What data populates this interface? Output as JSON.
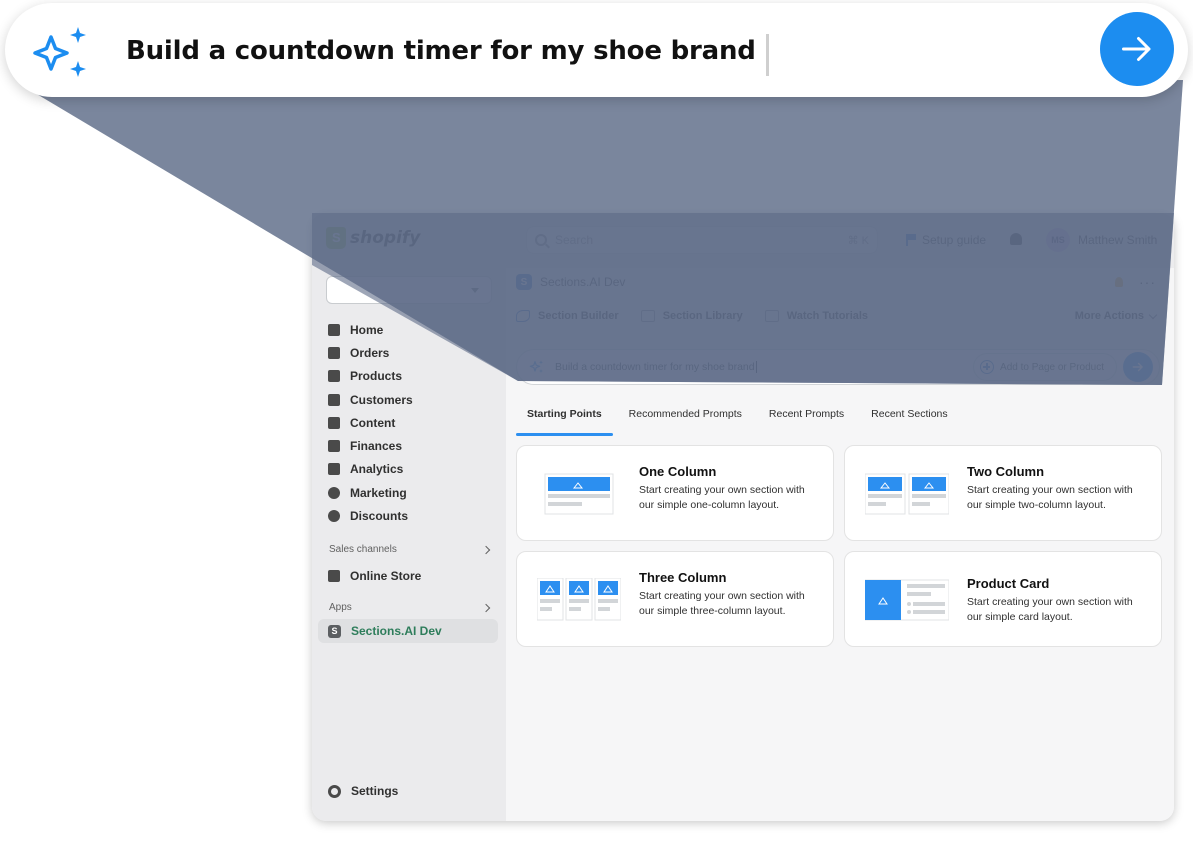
{
  "hero": {
    "prompt": "Build a countdown timer for my shoe brand",
    "icon": "sparkles-icon",
    "send_icon": "arrow-right-icon",
    "accent": "#1c8df0"
  },
  "topbar": {
    "logo_text": "shopify",
    "search_placeholder": "Search",
    "search_shortcut": "⌘ K",
    "setup_guide": "Setup guide",
    "user_initials": "MS",
    "user_name": "Matthew Smith"
  },
  "sidebar": {
    "items": [
      {
        "label": "Home",
        "icon": "home-icon"
      },
      {
        "label": "Orders",
        "icon": "inbox-icon"
      },
      {
        "label": "Products",
        "icon": "tag-icon"
      },
      {
        "label": "Customers",
        "icon": "person-icon"
      },
      {
        "label": "Content",
        "icon": "image-icon"
      },
      {
        "label": "Finances",
        "icon": "bank-icon"
      },
      {
        "label": "Analytics",
        "icon": "bar-chart-icon"
      },
      {
        "label": "Marketing",
        "icon": "target-icon"
      },
      {
        "label": "Discounts",
        "icon": "discount-icon"
      }
    ],
    "sales_channels_label": "Sales channels",
    "online_store": "Online Store",
    "apps_label": "Apps",
    "app_item": "Sections.AI Dev",
    "app_item_letter": "S",
    "settings": "Settings"
  },
  "main": {
    "app_title": "Sections.AI Dev",
    "app_letter": "S",
    "toolbar": {
      "section_builder": "Section Builder",
      "section_library": "Section Library",
      "watch_tutorials": "Watch Tutorials",
      "more_actions": "More Actions"
    },
    "prompt": "Build a countdown timer for my shoe brand",
    "add_button": "Add to Page or Product",
    "tabs": [
      "Starting Points",
      "Recommended Prompts",
      "Recent Prompts",
      "Recent Sections"
    ],
    "cards": [
      {
        "title": "One Column",
        "desc": "Start creating your own section with our simple one-column layout."
      },
      {
        "title": "Two Column",
        "desc": "Start creating your own section with our simple two-column layout."
      },
      {
        "title": "Three Column",
        "desc": "Start creating your own section with our simple three-column layout."
      },
      {
        "title": "Product Card",
        "desc": "Start creating your own section with our simple card layout."
      }
    ]
  }
}
